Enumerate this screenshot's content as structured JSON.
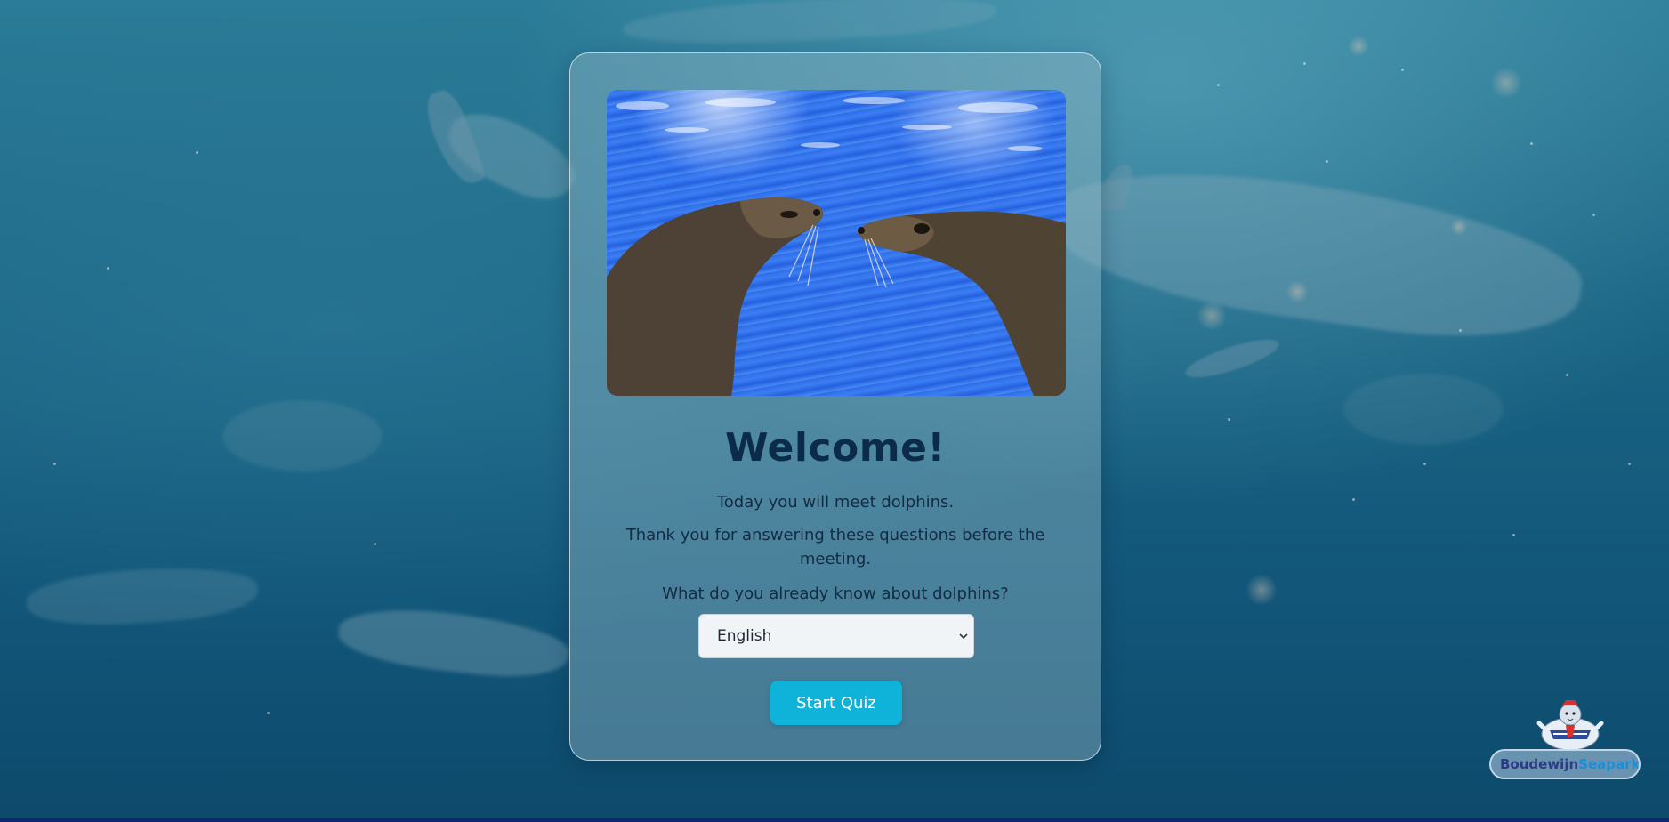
{
  "hero": {
    "image_alt": "Two sea lions touching noses over blue water"
  },
  "welcome": {
    "title": "Welcome!",
    "line1": "Today you will meet dolphins.",
    "line2": "Thank you for answering these questions before the meeting.",
    "line3": "What do you already know about dolphins?"
  },
  "language_select": {
    "selected": "English",
    "options": [
      "English"
    ]
  },
  "start_button": {
    "label": "Start Quiz"
  },
  "logo": {
    "name_part1": "Boudewijn",
    "name_part2": "Seapark"
  },
  "colors": {
    "button": "#0fb2d8",
    "title": "#0c2b4a",
    "background": "#1b6685"
  }
}
